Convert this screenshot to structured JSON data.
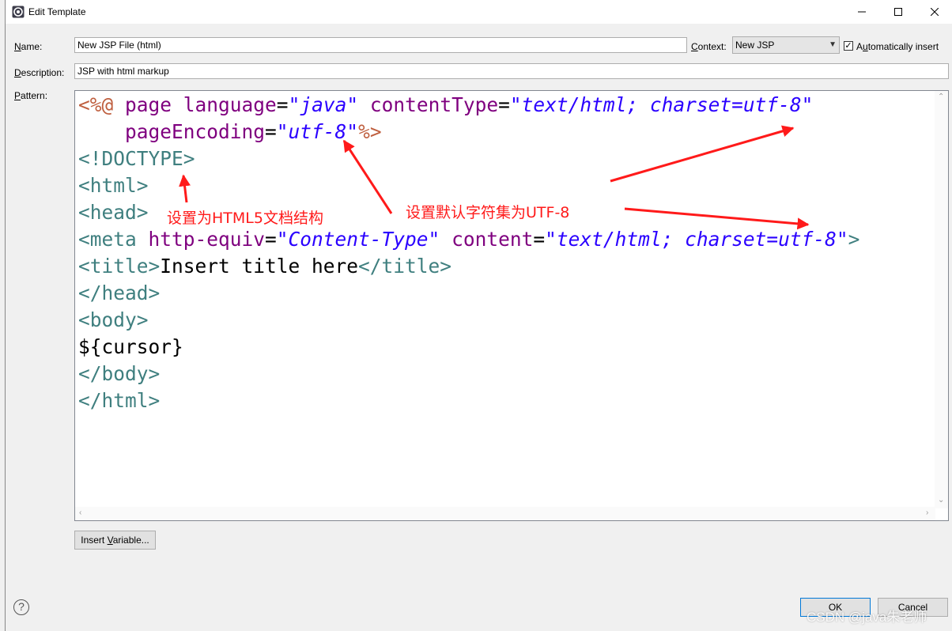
{
  "window": {
    "title": "Edit Template"
  },
  "form": {
    "name_label_u": "N",
    "name_label_rest": "ame:",
    "name_value": "New JSP File (html)",
    "context_label_u": "C",
    "context_label_rest": "ontext:",
    "context_value": "New JSP",
    "auto_insert_pre": "A",
    "auto_insert_u": "u",
    "auto_insert_rest": "tomatically insert",
    "auto_insert_checked": true,
    "description_label_u": "D",
    "description_label_rest": "escription:",
    "description_value": "JSP with html markup",
    "pattern_label_u": "P",
    "pattern_label_rest": "attern:"
  },
  "pattern": {
    "lines": [
      [
        [
          "brown",
          "<%@ "
        ],
        [
          "purple",
          "page "
        ],
        [
          "purple",
          "language"
        ],
        [
          "black",
          "="
        ],
        [
          "blue",
          "\"java\""
        ],
        [
          "black",
          " "
        ],
        [
          "purple",
          "contentType"
        ],
        [
          "black",
          "="
        ],
        [
          "blue",
          "\"text/html; charset=utf-8\""
        ]
      ],
      [
        [
          "black",
          "    "
        ],
        [
          "purple",
          "pageEncoding"
        ],
        [
          "black",
          "="
        ],
        [
          "blue",
          "\"utf-8\""
        ],
        [
          "brown",
          "%>"
        ]
      ],
      [
        [
          "teal",
          "<!DOCTYPE>"
        ]
      ],
      [
        [
          "teal",
          "<html>"
        ]
      ],
      [
        [
          "teal",
          "<head>"
        ]
      ],
      [
        [
          "teal",
          "<meta "
        ],
        [
          "purple",
          "http-equiv"
        ],
        [
          "black",
          "="
        ],
        [
          "blue",
          "\"Content-Type\""
        ],
        [
          "black",
          " "
        ],
        [
          "purple",
          "content"
        ],
        [
          "black",
          "="
        ],
        [
          "blue",
          "\"text/html; charset=utf-8\""
        ],
        [
          "teal",
          ">"
        ]
      ],
      [
        [
          "teal",
          "<title>"
        ],
        [
          "black",
          "Insert title here"
        ],
        [
          "teal",
          "</title>"
        ]
      ],
      [
        [
          "teal",
          "</head>"
        ]
      ],
      [
        [
          "teal",
          "<body>"
        ]
      ],
      [
        [
          "black",
          "${cursor}"
        ]
      ],
      [
        [
          "teal",
          "</body>"
        ]
      ],
      [
        [
          "teal",
          "</html>"
        ]
      ]
    ]
  },
  "buttons": {
    "insert_variable_pre": "Insert ",
    "insert_variable_u": "V",
    "insert_variable_rest": "ariable...",
    "ok": "OK",
    "cancel": "Cancel"
  },
  "annotations": {
    "html5": "设置为HTML5文档结构",
    "utf8": "设置默认字符集为UTF-8",
    "color": "#ff1a1a"
  },
  "watermark": "CSDN @java朱老师",
  "icons": [
    "eclipse-template-icon",
    "minimize-icon",
    "maximize-icon",
    "close-icon",
    "chevron-down-icon",
    "checkmark-icon",
    "help-icon"
  ]
}
